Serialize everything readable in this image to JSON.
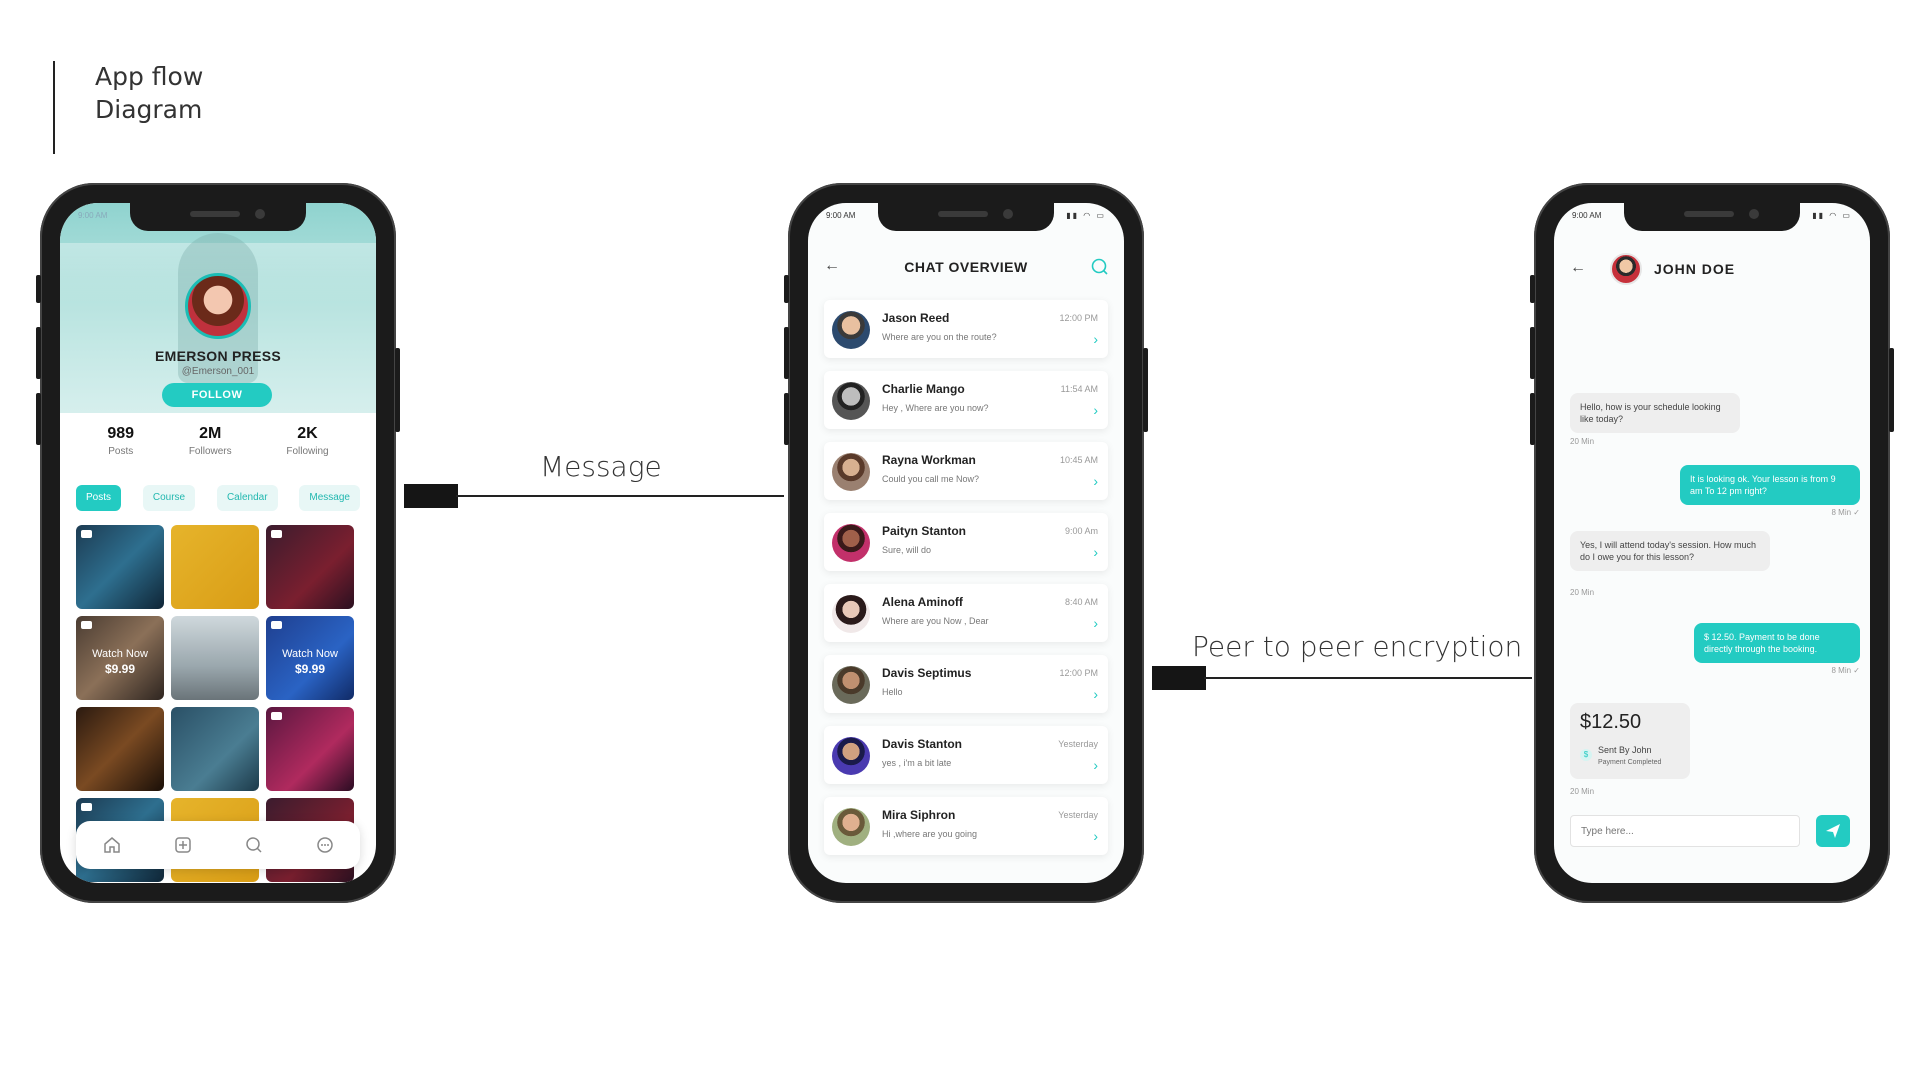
{
  "heading": {
    "line1": "App flow",
    "line2": "Diagram"
  },
  "connectors": {
    "message_label": "Message",
    "encryption_label": "Peer to peer encryption"
  },
  "profile": {
    "status_time": "9:00 AM",
    "name": "EMERSON PRESS",
    "handle": "@Emerson_001",
    "follow_label": "FOLLOW",
    "stats": [
      {
        "value": "989",
        "label": "Posts"
      },
      {
        "value": "2M",
        "label": "Followers"
      },
      {
        "value": "2K",
        "label": "Following"
      }
    ],
    "tabs": [
      "Posts",
      "Course",
      "Calendar",
      "Message"
    ],
    "watch_label": "Watch Now",
    "price": "$9.99",
    "nav_icons": [
      "home-icon",
      "add-icon",
      "search-icon",
      "chat-icon"
    ]
  },
  "chat_overview": {
    "status_time": "9:00 AM",
    "title": "CHAT OVERVIEW",
    "chats": [
      {
        "name": "Jason Reed",
        "message": "Where are you on the route?",
        "time": "12:00 PM"
      },
      {
        "name": "Charlie Mango",
        "message": "Hey , Where are you now?",
        "time": "11:54 AM"
      },
      {
        "name": "Rayna Workman",
        "message": "Could you call me Now?",
        "time": "10:45 AM"
      },
      {
        "name": "Paityn Stanton",
        "message": "Sure, will do",
        "time": "9:00 Am"
      },
      {
        "name": "Alena Aminoff",
        "message": "Where are you Now , Dear",
        "time": "8:40 AM"
      },
      {
        "name": "Davis Septimus",
        "message": "Hello",
        "time": "12:00 PM"
      },
      {
        "name": "Davis Stanton",
        "message": "yes , i'm a bit late",
        "time": "Yesterday"
      },
      {
        "name": "Mira Siphron",
        "message": "Hi ,where are you going",
        "time": "Yesterday"
      }
    ]
  },
  "conversation": {
    "status_time": "9:00 AM",
    "contact_name": "JOHN DOE",
    "messages": [
      {
        "dir": "in",
        "text": "Hello, how is your schedule looking like today?",
        "meta": "20 Min"
      },
      {
        "dir": "out",
        "text": "It is looking ok. Your lesson is from 9 am To 12 pm right?",
        "meta": "8 Min ✓"
      },
      {
        "dir": "in",
        "text": "Yes, I will attend today's session. How much do I owe you for this lesson?",
        "meta": "20 Min"
      },
      {
        "dir": "out",
        "text": "$ 12.50. Payment to be done directly through the booking.",
        "meta": "8 Min ✓"
      }
    ],
    "payment": {
      "amount": "$12.50",
      "sent_by": "Sent By John",
      "status": "Payment Completed",
      "meta": "20 Min"
    },
    "composer_placeholder": "Type here..."
  }
}
